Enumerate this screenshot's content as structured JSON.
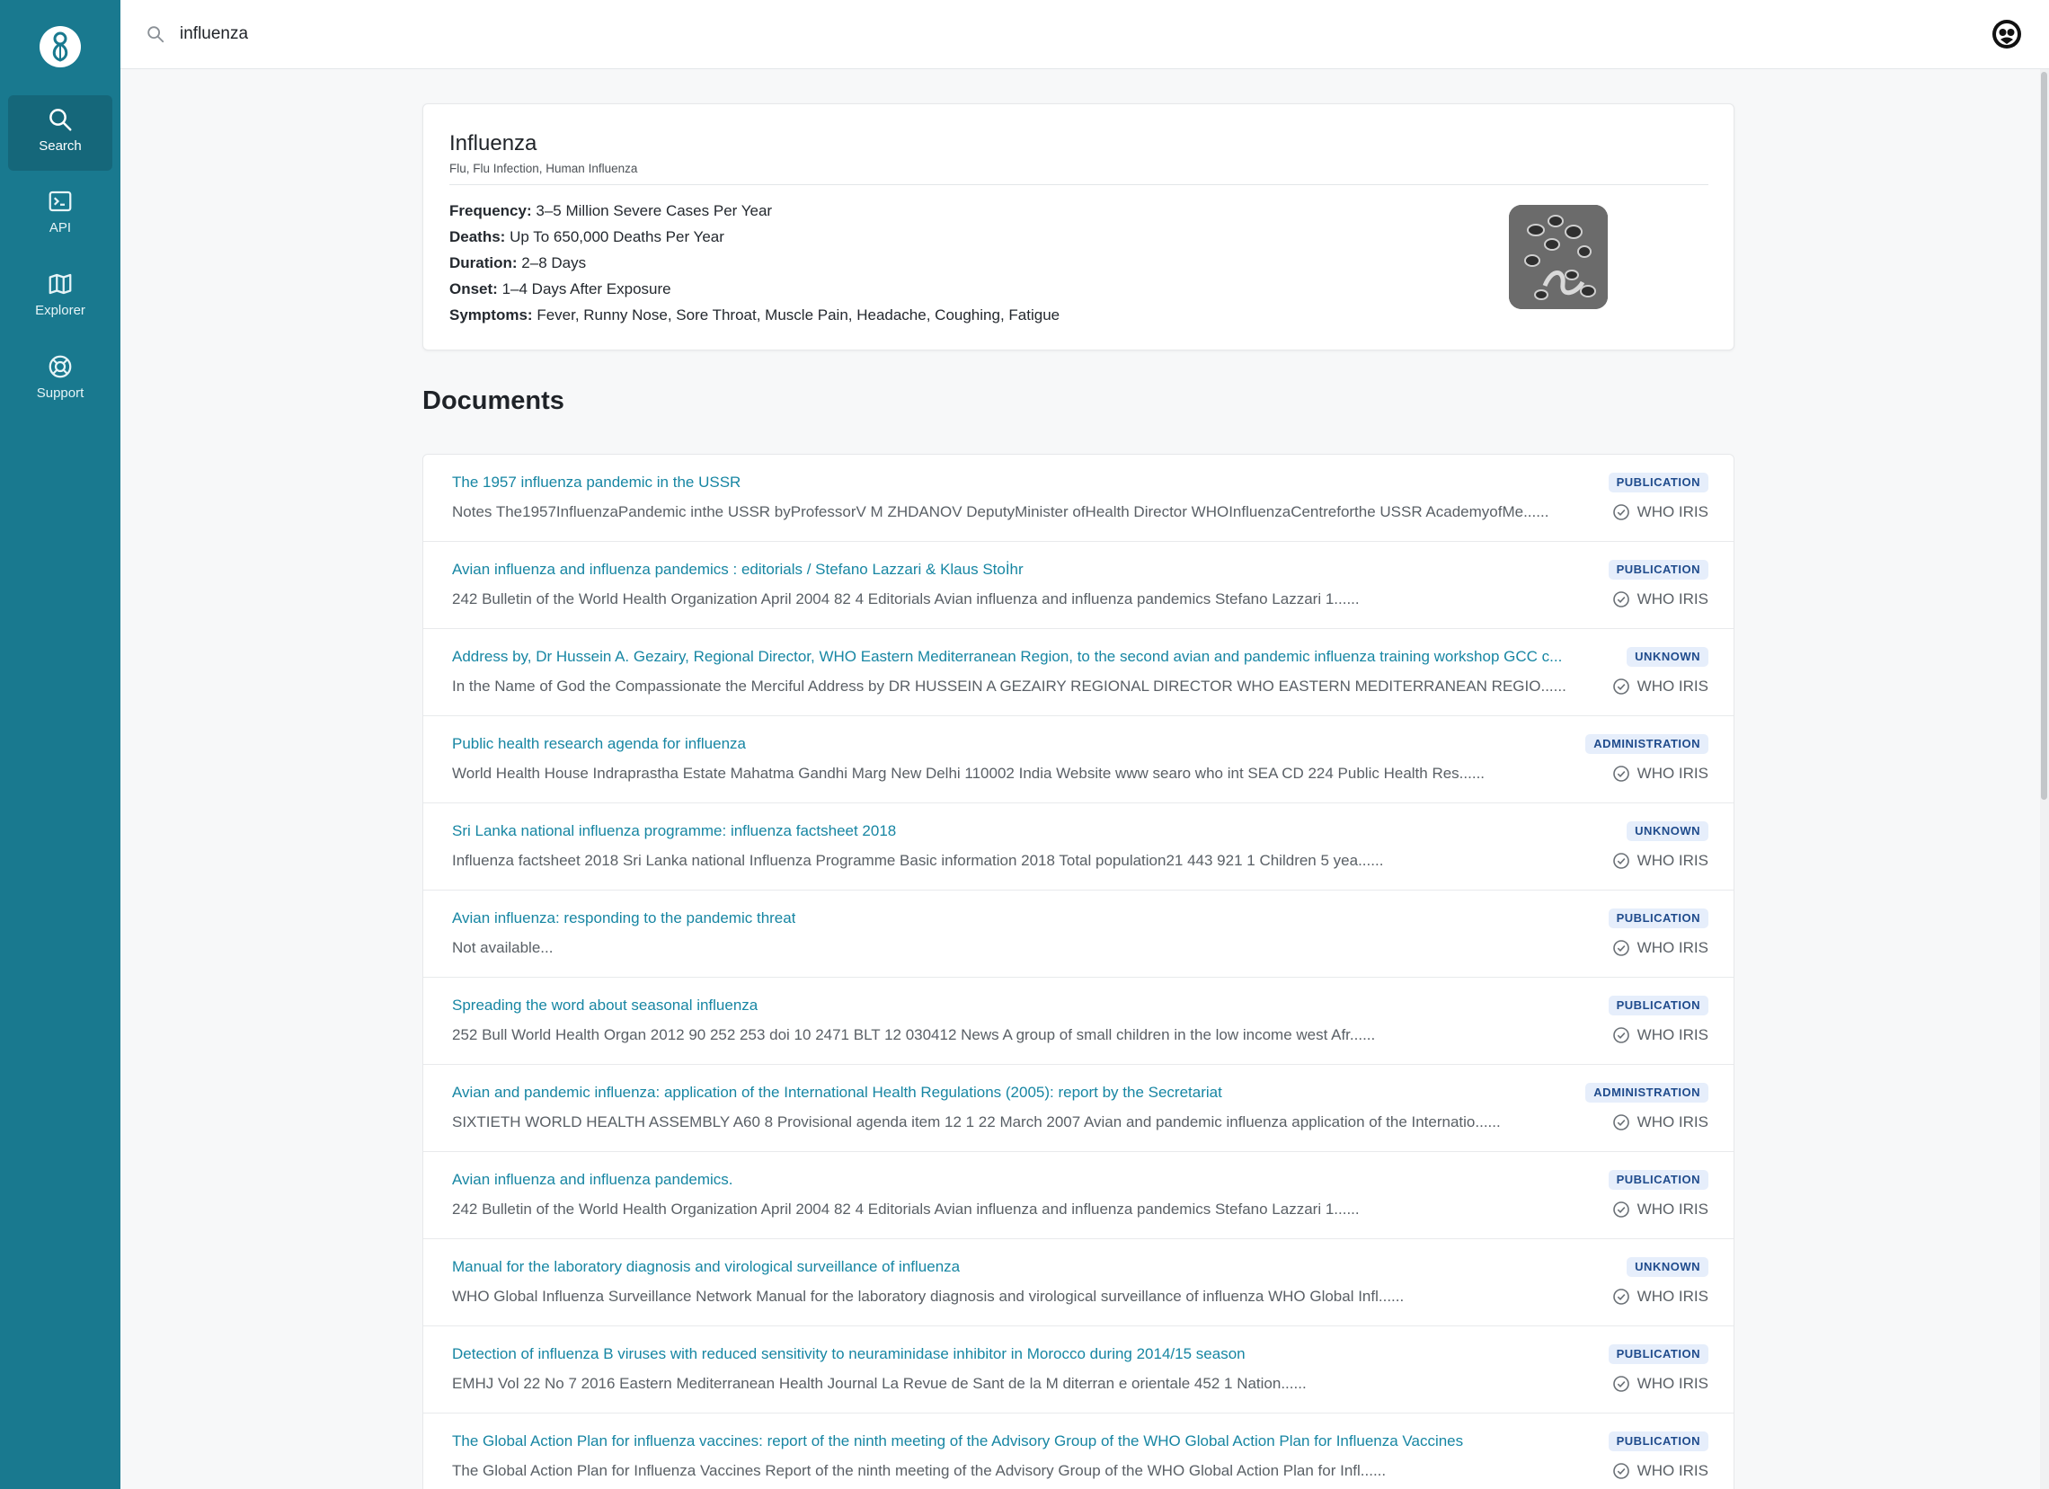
{
  "nav": {
    "items": [
      {
        "label": "Search",
        "icon": "search-icon"
      },
      {
        "label": "API",
        "icon": "terminal-icon"
      },
      {
        "label": "Explorer",
        "icon": "map-icon"
      },
      {
        "label": "Support",
        "icon": "lifebuoy-icon"
      }
    ]
  },
  "search": {
    "value": "influenza"
  },
  "summary": {
    "title": "Influenza",
    "aliases": "Flu, Flu Infection, Human Influenza",
    "facts": [
      {
        "label": "Frequency:",
        "value": "3–5 Million Severe Cases Per Year"
      },
      {
        "label": "Deaths:",
        "value": "Up To 650,000 Deaths Per Year"
      },
      {
        "label": "Duration:",
        "value": "2–8 Days"
      },
      {
        "label": "Onset:",
        "value": "1–4 Days After Exposure"
      },
      {
        "label": "Symptoms:",
        "value": "Fever, Runny Nose, Sore Throat, Muscle Pain, Headache, Coughing, Fatigue"
      }
    ]
  },
  "documents": {
    "heading": "Documents",
    "items": [
      {
        "title": "The 1957 influenza pandemic in the USSR",
        "snippet": "Notes The1957InfluenzaPandemic inthe USSR byProfessorV M ZHDANOV DeputyMinister ofHealth Director WHOInfluenzaCentreforthe USSR AcademyofMe......",
        "badge": "PUBLICATION",
        "source": "WHO IRIS"
      },
      {
        "title": "Avian influenza and influenza pandemics : editorials / Stefano Lazzari & Klaus Stoİhr",
        "snippet": "242 Bulletin of the World Health Organization April 2004 82 4 Editorials Avian influenza and influenza pandemics Stefano Lazzari 1......",
        "badge": "PUBLICATION",
        "source": "WHO IRIS"
      },
      {
        "title": "Address by, Dr Hussein A. Gezairy, Regional Director, WHO Eastern Mediterranean Region, to the second avian and pandemic influenza training workshop GCC c...",
        "snippet": "In the Name of God the Compassionate the Merciful Address by DR HUSSEIN A GEZAIRY REGIONAL DIRECTOR WHO EASTERN MEDITERRANEAN REGIO......",
        "badge": "UNKNOWN",
        "source": "WHO IRIS"
      },
      {
        "title": "Public health research agenda for influenza",
        "snippet": "World Health House Indraprastha Estate Mahatma Gandhi Marg New Delhi 110002 India Website www searo who int SEA CD 224 Public Health Res......",
        "badge": "ADMINISTRATION",
        "source": "WHO IRIS"
      },
      {
        "title": "Sri Lanka national influenza programme: influenza factsheet 2018",
        "snippet": "Influenza factsheet 2018 Sri Lanka national Influenza Programme Basic information 2018 Total population21 443 921 1 Children 5 yea......",
        "badge": "UNKNOWN",
        "source": "WHO IRIS"
      },
      {
        "title": "Avian influenza: responding to the pandemic threat",
        "snippet": "Not available...",
        "badge": "PUBLICATION",
        "source": "WHO IRIS"
      },
      {
        "title": "Spreading the word about seasonal influenza",
        "snippet": "252 Bull World Health Organ 2012 90 252 253 doi 10 2471 BLT 12 030412 News A group of small children in the low income west Afr......",
        "badge": "PUBLICATION",
        "source": "WHO IRIS"
      },
      {
        "title": "Avian and pandemic influenza: application of the International Health Regulations (2005): report by the Secretariat",
        "snippet": "SIXTIETH WORLD HEALTH ASSEMBLY A60 8 Provisional agenda item 12 1 22 March 2007 Avian and pandemic influenza application of the Internatio......",
        "badge": "ADMINISTRATION",
        "source": "WHO IRIS"
      },
      {
        "title": "Avian influenza and influenza pandemics.",
        "snippet": "242 Bulletin of the World Health Organization April 2004 82 4 Editorials Avian influenza and influenza pandemics Stefano Lazzari 1......",
        "badge": "PUBLICATION",
        "source": "WHO IRIS"
      },
      {
        "title": "Manual for the laboratory diagnosis and virological surveillance of influenza",
        "snippet": "WHO Global Influenza Surveillance Network Manual for the laboratory diagnosis and virological surveillance of influenza WHO Global Infl......",
        "badge": "UNKNOWN",
        "source": "WHO IRIS"
      },
      {
        "title": "Detection of influenza B viruses with reduced sensitivity to neuraminidase inhibitor in Morocco during 2014/15 season",
        "snippet": "EMHJ Vol 22 No 7 2016 Eastern Mediterranean Health Journal La Revue de Sant de la M diterran e orientale 452 1 Nation......",
        "badge": "PUBLICATION",
        "source": "WHO IRIS"
      },
      {
        "title": "The Global Action Plan for influenza vaccines: report of the ninth meeting of the Advisory Group of the WHO Global Action Plan for Influenza Vaccines",
        "snippet": "The Global Action Plan for Influenza Vaccines Report of the ninth meeting of the Advisory Group of the WHO Global Action Plan for Infl......",
        "badge": "PUBLICATION",
        "source": "WHO IRIS"
      }
    ]
  },
  "colors": {
    "sidebar": "#19798f",
    "sidebar_active": "#15677a",
    "link": "#1786a3",
    "badge_bg": "#e6eefb",
    "badge_text": "#1f4b8c"
  }
}
